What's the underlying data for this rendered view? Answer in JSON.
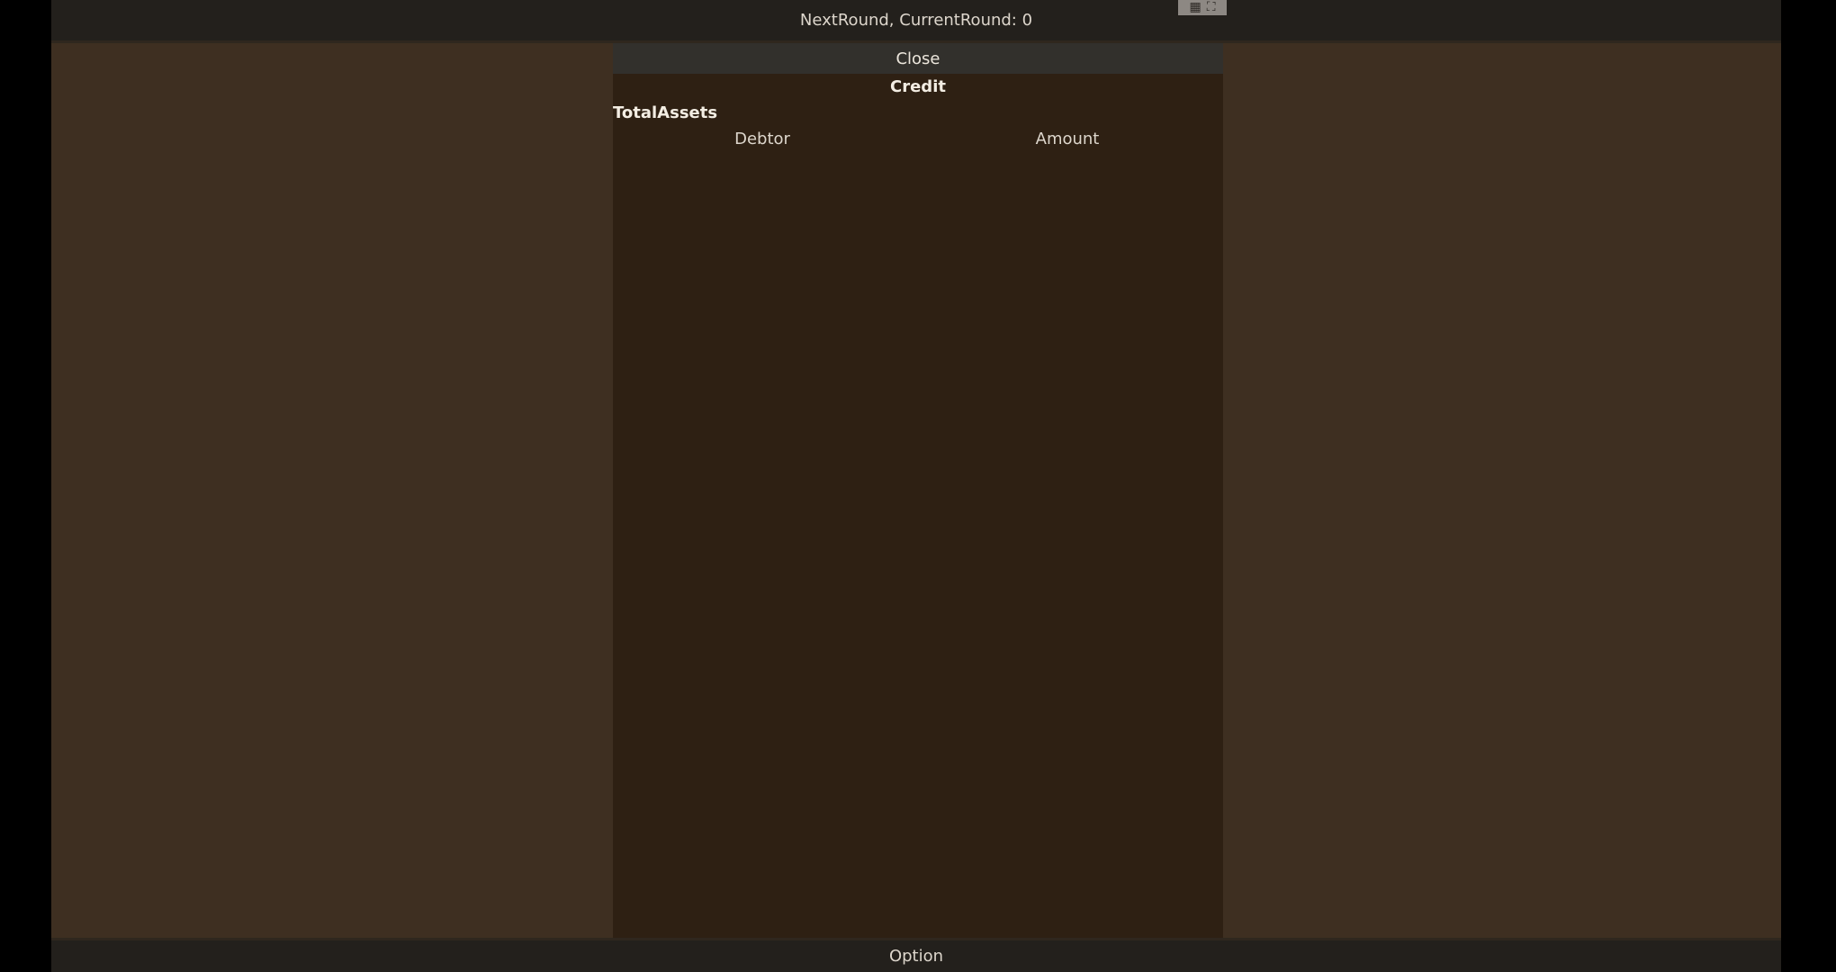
{
  "top_bar": {
    "status_text": "NextRound, CurrentRound: 0"
  },
  "top_widget": {
    "icon_a": "▦",
    "icon_b": "⛶"
  },
  "panel": {
    "close_label": "Close",
    "title": "Credit",
    "total_assets_label": "TotalAssets",
    "columns": [
      "Debtor",
      "Amount"
    ]
  },
  "bottom_bar": {
    "option_label": "Option"
  },
  "colors": {
    "background": "#3e2f21",
    "panel": "#2e2013",
    "bar": "#23201c",
    "button": "#32302c"
  }
}
